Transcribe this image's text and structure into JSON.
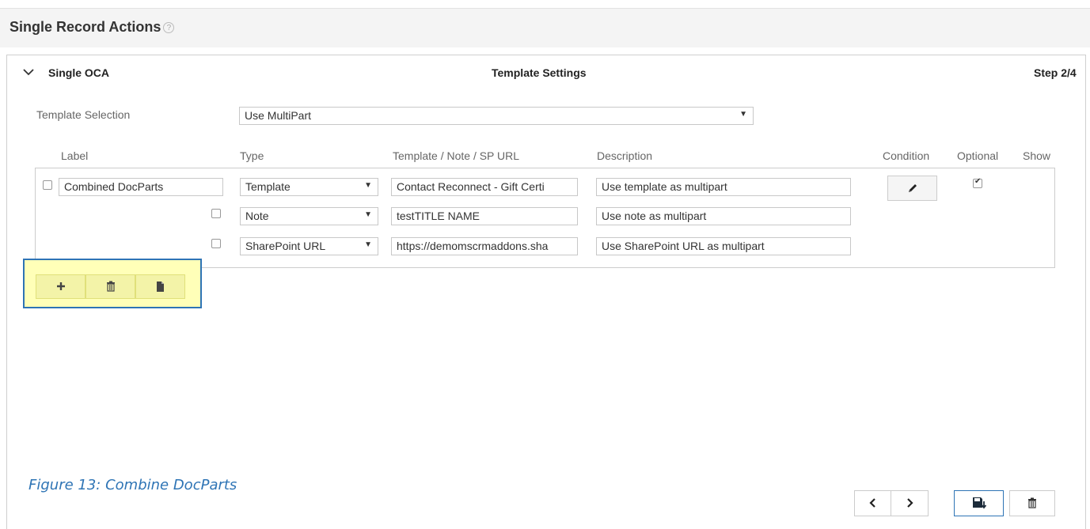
{
  "header": {
    "title": "Single Record Actions",
    "help_icon": "?"
  },
  "panel": {
    "section_label": "Single OCA",
    "settings_title": "Template Settings",
    "step": "Step 2/4"
  },
  "template_selection": {
    "label": "Template Selection",
    "value": "Use MultiPart"
  },
  "columns": {
    "label": "Label",
    "type": "Type",
    "url": "Template / Note / SP URL",
    "description": "Description",
    "condition": "Condition",
    "optional": "Optional",
    "show": "Show"
  },
  "group": {
    "label_value": "Combined DocParts",
    "optional_checked": true
  },
  "rows": [
    {
      "type": "Template",
      "url": "Contact Reconnect - Gift Certi",
      "description": "Use template as multipart"
    },
    {
      "type": "Note",
      "url": "testTITLE NAME",
      "description": "Use note as multipart"
    },
    {
      "type": "SharePoint URL",
      "url": "https://demomscrmaddons.sha",
      "description": "Use SharePoint URL as multipart"
    }
  ],
  "toolbar": {
    "add_icon": "plus-icon",
    "delete_icon": "trash-icon",
    "document_icon": "document-icon"
  },
  "caption": "Figure 13: Combine DocParts",
  "nav": {
    "prev": "‹",
    "next": "›"
  },
  "colors": {
    "highlight_bg": "#ffffb8",
    "highlight_border": "#2e74b5",
    "caption": "#2e74b5"
  }
}
